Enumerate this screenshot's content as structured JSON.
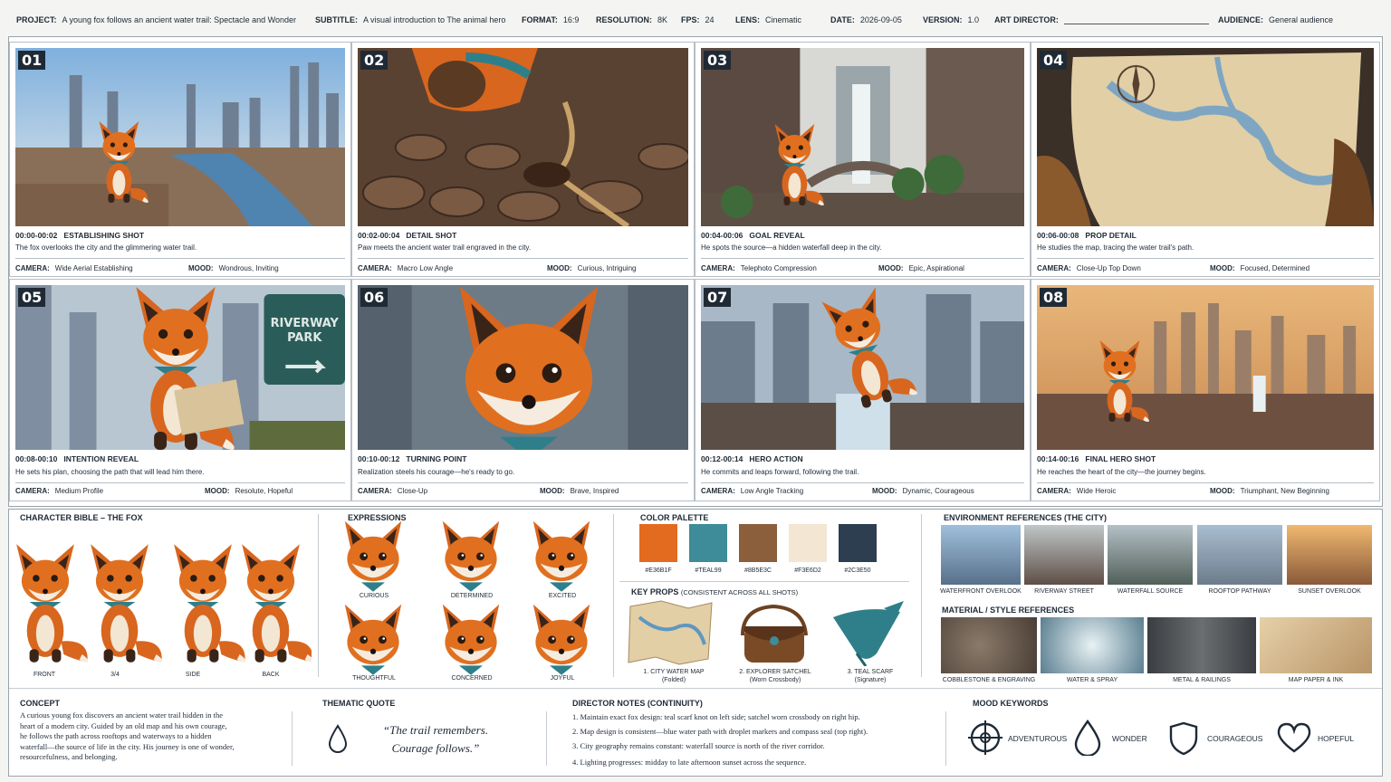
{
  "header": {
    "project": {
      "label": "PROJECT:",
      "value": "A young fox follows an ancient water trail: Spectacle and Wonder"
    },
    "subtitle": {
      "label": "SUBTITLE:",
      "value": "A visual introduction to The animal hero"
    },
    "format": {
      "label": "FORMAT:",
      "value": "16:9"
    },
    "resolution": {
      "label": "RESOLUTION:",
      "value": "8K"
    },
    "fps": {
      "label": "FPS:",
      "value": "24"
    },
    "lens": {
      "label": "LENS:",
      "value": "Cinematic"
    },
    "date": {
      "label": "DATE:",
      "value": "2026-09-05"
    },
    "version": {
      "label": "VERSION:",
      "value": "1.0"
    },
    "art_director": {
      "label": "ART DIRECTOR:"
    },
    "audience": {
      "label": "AUDIENCE:",
      "value": "General audience"
    }
  },
  "labels": {
    "camera": "CAMERA:",
    "mood": "MOOD:"
  },
  "shots": [
    {
      "num": "01",
      "time": "00:00-00:02",
      "type": "ESTABLISHING SHOT",
      "desc": "The fox overlooks the city and the glimmering water trail.",
      "camera": "Wide Aerial Establishing",
      "mood": "Wondrous, Inviting"
    },
    {
      "num": "02",
      "time": "00:02-00:04",
      "type": "DETAIL SHOT",
      "desc": "Paw meets the ancient water trail engraved in the city.",
      "camera": "Macro Low Angle",
      "mood": "Curious, Intriguing"
    },
    {
      "num": "03",
      "time": "00:04-00:06",
      "type": "GOAL REVEAL",
      "desc": "He spots the source—a hidden waterfall deep in the city.",
      "camera": "Telephoto Compression",
      "mood": "Epic, Aspirational"
    },
    {
      "num": "04",
      "time": "00:06-00:08",
      "type": "PROP DETAIL",
      "desc": "He studies the map, tracing the water trail's path.",
      "camera": "Close-Up Top Down",
      "mood": "Focused, Determined"
    },
    {
      "num": "05",
      "time": "00:08-00:10",
      "type": "INTENTION REVEAL",
      "desc": "He sets his plan, choosing the path that will lead him there.",
      "camera": "Medium Profile",
      "mood": "Resolute, Hopeful"
    },
    {
      "num": "06",
      "time": "00:10-00:12",
      "type": "TURNING POINT",
      "desc": "Realization steels his courage—he's ready to go.",
      "camera": "Close-Up",
      "mood": "Brave, Inspired"
    },
    {
      "num": "07",
      "time": "00:12-00:14",
      "type": "HERO ACTION",
      "desc": "He commits and leaps forward, following the trail.",
      "camera": "Low Angle Tracking",
      "mood": "Dynamic, Courageous"
    },
    {
      "num": "08",
      "time": "00:14-00:16",
      "type": "FINAL HERO SHOT",
      "desc": "He reaches the heart of the city—the journey begins.",
      "camera": "Wide Heroic",
      "mood": "Triumphant, New Beginning"
    }
  ],
  "sign": {
    "line1": "RIVERWAY",
    "line2": "PARK"
  },
  "character": {
    "title": "CHARACTER BIBLE – THE FOX",
    "views": [
      "FRONT",
      "3/4",
      "SIDE",
      "BACK"
    ]
  },
  "expressions": {
    "title": "EXPRESSIONS",
    "items": [
      "CURIOUS",
      "DETERMINED",
      "EXCITED",
      "THOUGHTFUL",
      "CONCERNED",
      "JOYFUL"
    ]
  },
  "palette": {
    "title": "COLOR PALETTE",
    "colors": [
      {
        "hex": "#E36B1F",
        "label": "#E36B1F"
      },
      {
        "hex": "#3E8C99",
        "label": "#TEAL99"
      },
      {
        "hex": "#8B5E3C",
        "label": "#8B5E3C"
      },
      {
        "hex": "#F3E6D2",
        "label": "#F3E6D2"
      },
      {
        "hex": "#2C3E50",
        "label": "#2C3E50"
      }
    ]
  },
  "props": {
    "title": "KEY PROPS",
    "subtitle": "(CONSISTENT ACROSS ALL SHOTS)",
    "items": [
      {
        "name": "1. CITY WATER MAP",
        "note": "(Folded)"
      },
      {
        "name": "2. EXPLORER SATCHEL",
        "note": "(Worn Crossbody)"
      },
      {
        "name": "3. TEAL SCARF",
        "note": "(Signature)"
      }
    ]
  },
  "environment": {
    "title": "ENVIRONMENT REFERENCES (THE CITY)",
    "items": [
      "WATERFRONT OVERLOOK",
      "RIVERWAY STREET",
      "WATERFALL SOURCE",
      "ROOFTOP PATHWAY",
      "SUNSET OVERLOOK"
    ]
  },
  "materials": {
    "title": "MATERIAL / STYLE REFERENCES",
    "items": [
      "COBBLESTONE & ENGRAVING",
      "WATER & SPRAY",
      "METAL & RAILINGS",
      "MAP PAPER & INK"
    ]
  },
  "concept": {
    "title": "CONCEPT",
    "lines": [
      "A curious young fox discovers an ancient water trail hidden in the",
      "heart of a modern city. Guided by an old map and his own courage,",
      "he follows the path across rooftops and waterways to a hidden",
      "waterfall—the source of life in the city. His journey is one of wonder,",
      "resourcefulness, and belonging."
    ]
  },
  "quote": {
    "title": "THEMATIC QUOTE",
    "line1": "“The trail remembers.",
    "line2": "Courage follows.”"
  },
  "notes": {
    "title": "DIRECTOR NOTES (CONTINUITY)",
    "items": [
      "1.  Maintain exact fox design: teal scarf knot on left side; satchel worn crossbody on right hip.",
      "2.  Map design is consistent—blue water path with droplet markers and compass seal (top right).",
      "3.  City geography remains constant: waterfall source is north of the river corridor.",
      "4.  Lighting progresses: midday to late afternoon sunset across the sequence."
    ]
  },
  "mood_keywords": {
    "title": "MOOD KEYWORDS",
    "items": [
      {
        "icon": "compass-icon",
        "label": "ADVENTUROUS"
      },
      {
        "icon": "droplet-icon",
        "label": "WONDER"
      },
      {
        "icon": "shield-icon",
        "label": "COURAGEOUS"
      },
      {
        "icon": "heart-icon",
        "label": "HOPEFUL"
      }
    ]
  }
}
